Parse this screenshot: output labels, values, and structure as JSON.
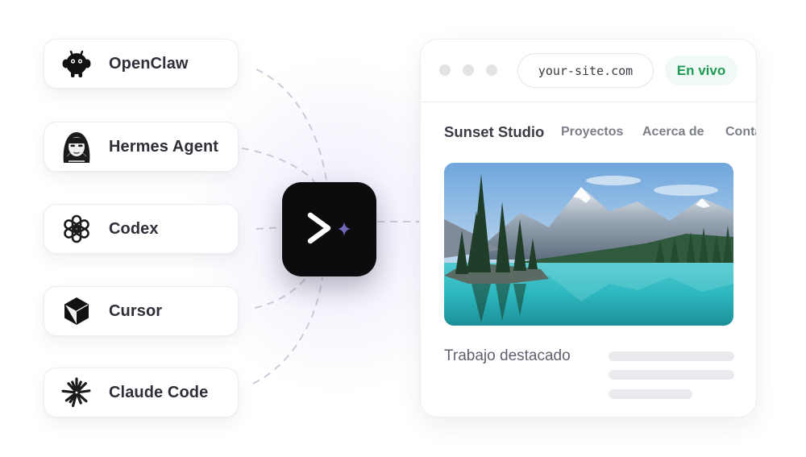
{
  "agents": [
    {
      "name": "OpenClaw",
      "icon": "openclaw-robot-icon"
    },
    {
      "name": "Hermes Agent",
      "icon": "hermes-portrait-icon"
    },
    {
      "name": "Codex",
      "icon": "openai-knot-icon"
    },
    {
      "name": "Cursor",
      "icon": "cursor-cube-icon"
    },
    {
      "name": "Claude Code",
      "icon": "claude-asterisk-icon"
    }
  ],
  "hub": {
    "icon": "terminal-sparkle-icon"
  },
  "browser": {
    "url": "your-site.com",
    "status": "En vivo",
    "site_title": "Sunset Studio",
    "nav": [
      "Proyectos",
      "Acerca de",
      "Contacto"
    ],
    "hero_image": "mountain-lake-landscape",
    "featured_heading": "Trabajo destacado"
  },
  "colors": {
    "hub_bg": "#0c0c0f",
    "sparkle": "#6e6ab8",
    "live_text": "#1f9a57",
    "live_bg": "#f0f9f3",
    "connector": "#c6ccd8"
  }
}
